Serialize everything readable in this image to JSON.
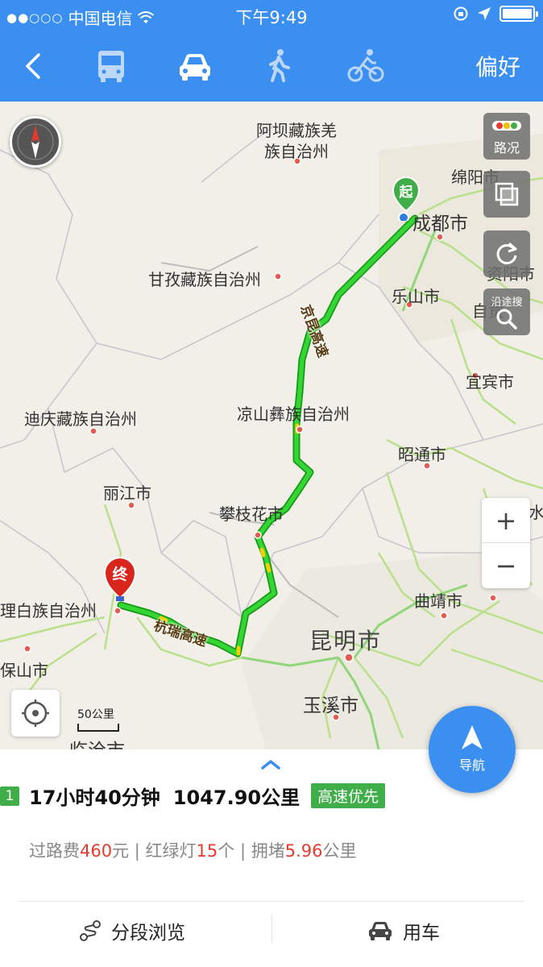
{
  "status_bar": {
    "signal": "●●○○○",
    "carrier": "中国电信",
    "time": "下午9:49"
  },
  "nav": {
    "back_icon": "chevron-left-icon",
    "modes": [
      {
        "name": "bus",
        "icon": "bus-icon"
      },
      {
        "name": "car",
        "icon": "car-icon",
        "selected": true
      },
      {
        "name": "walk",
        "icon": "walk-icon"
      },
      {
        "name": "bike",
        "icon": "bike-icon"
      }
    ],
    "prefs_label": "偏好"
  },
  "map": {
    "buttons": {
      "traffic": "路况",
      "search_along": "沿途搜"
    },
    "labels": {
      "aba": "阿坝藏族羌",
      "aba2": "族自治州",
      "mianyang": "绵阳市",
      "chengdu": "成都市",
      "ganzi": "甘孜藏族自治州",
      "ziyang": "资阳市",
      "leshan": "乐山市",
      "zigong": "自贡",
      "yibin": "宜宾市",
      "diqing": "迪庆藏族自治州",
      "liangshan": "凉山彝族自治州",
      "zhaotong": "昭通市",
      "lijiang": "丽江市",
      "panzhihua": "攀枝花市",
      "dali": "理白族自治州",
      "qujing": "曲靖市",
      "baoshan": "保山市",
      "kunming": "昆明市",
      "yuxi": "玉溪市",
      "lincang": "临沧市",
      "shui": "水"
    },
    "highways": {
      "jingkun": "京昆高速",
      "hangrui": "杭瑞高速"
    },
    "markers": {
      "start": "起",
      "end": "终"
    },
    "scale_label": "50公里",
    "zoom_in": "+",
    "zoom_out": "−",
    "nav_button_label": "导航",
    "colors": {
      "route": "#2ecc2e",
      "route_edge": "#159a15",
      "start_marker": "#3fae49",
      "end_marker": "#d9261c",
      "accent": "#3b8ff0"
    }
  },
  "route": {
    "index": "1",
    "duration": "17小时40分钟",
    "distance": "1047.90公里",
    "tag": "高速优先",
    "info": {
      "toll_label": "过路费",
      "toll_value": "460",
      "toll_unit": "元",
      "sep1": " | ",
      "lights_label": "红绿灯",
      "lights_value": "15",
      "lights_unit": "个",
      "sep2": " | ",
      "jam_label": "拥堵",
      "jam_value": "5.96",
      "jam_unit": "公里"
    }
  },
  "actions": {
    "segments": "分段浏览",
    "car": "用车"
  }
}
